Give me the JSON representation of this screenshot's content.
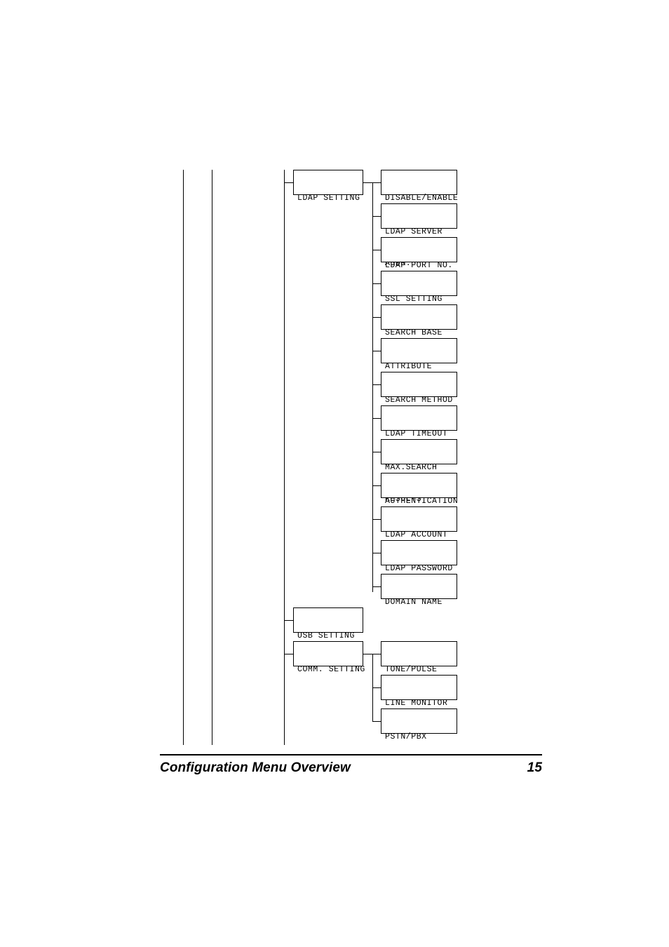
{
  "document": {
    "footer": {
      "title": "Configuration Menu Overview",
      "page_number": "15"
    }
  },
  "diagram": {
    "type": "menu-tree",
    "branches": [
      {
        "id": "ldap-setting",
        "label": "LDAP SETTING",
        "label_lines": [
          "LDAP SETTING"
        ],
        "children": [
          {
            "id": "disable-enable",
            "label": "DISABLE/ENABLE",
            "label_lines": [
              "DISABLE/ENABLE"
            ]
          },
          {
            "id": "ldap-server-addr",
            "label": "LDAP SERVER ADDR.",
            "label_lines": [
              "LDAP SERVER",
              "ADDR."
            ]
          },
          {
            "id": "ldap-port-no",
            "label": "LDAP PORT NO.",
            "label_lines": [
              "LDAP PORT NO."
            ]
          },
          {
            "id": "ssl-setting",
            "label": "SSL SETTING",
            "label_lines": [
              "SSL SETTING"
            ]
          },
          {
            "id": "search-base",
            "label": "SEARCH BASE",
            "label_lines": [
              "SEARCH BASE"
            ]
          },
          {
            "id": "attribute",
            "label": "ATTRIBUTE",
            "label_lines": [
              "ATTRIBUTE"
            ]
          },
          {
            "id": "search-method",
            "label": "SEARCH METHOD",
            "label_lines": [
              "SEARCH METHOD"
            ]
          },
          {
            "id": "ldap-timeout",
            "label": "LDAP TIMEOUT",
            "label_lines": [
              "LDAP TIMEOUT"
            ]
          },
          {
            "id": "max-search-results",
            "label": "MAX.SEARCH RESULTS",
            "label_lines": [
              "MAX.SEARCH",
              "RESULTS"
            ]
          },
          {
            "id": "authentication",
            "label": "AUTHENTICATION",
            "label_lines": [
              "AUTHENTICATION"
            ]
          },
          {
            "id": "ldap-account",
            "label": "LDAP ACCOUNT",
            "label_lines": [
              "LDAP ACCOUNT"
            ]
          },
          {
            "id": "ldap-password",
            "label": "LDAP PASSWORD",
            "label_lines": [
              "LDAP PASSWORD"
            ]
          },
          {
            "id": "domain-name",
            "label": "DOMAIN NAME",
            "label_lines": [
              "DOMAIN NAME"
            ]
          }
        ]
      },
      {
        "id": "usb-setting",
        "label": "USB SETTING",
        "label_lines": [
          "USB SETTING"
        ],
        "children": []
      },
      {
        "id": "comm-setting",
        "label": "COMM. SETTING",
        "label_lines": [
          "COMM. SETTING"
        ],
        "children": [
          {
            "id": "tone-pulse",
            "label": "TONE/PULSE",
            "label_lines": [
              "TONE/PULSE"
            ]
          },
          {
            "id": "line-monitor",
            "label": "LINE MONITOR",
            "label_lines": [
              "LINE MONITOR"
            ]
          },
          {
            "id": "pstn-pbx",
            "label": "PSTN/PBX",
            "label_lines": [
              "PSTN/PBX"
            ]
          }
        ]
      }
    ]
  }
}
